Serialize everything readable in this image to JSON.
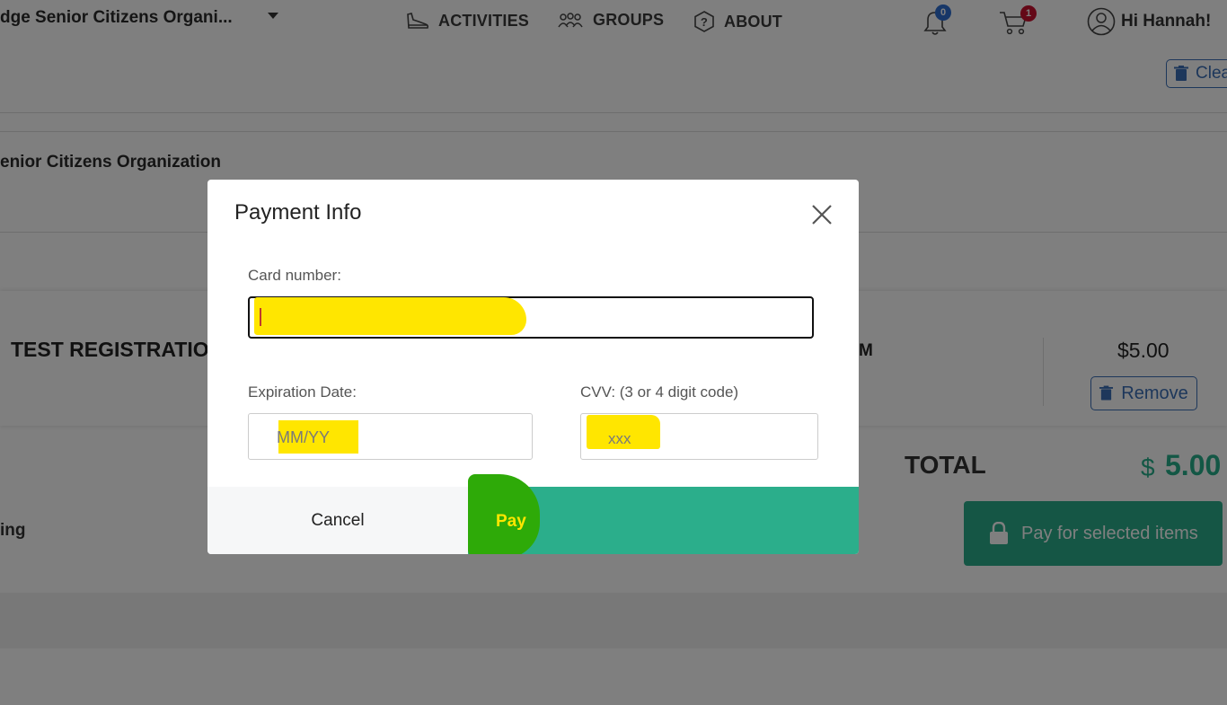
{
  "header": {
    "org_name": "dge Senior Citizens Organi...",
    "nav": [
      {
        "label": "ACTIVITIES",
        "icon": "shoe-icon"
      },
      {
        "label": "GROUPS",
        "icon": "people-icon"
      },
      {
        "label": "ABOUT",
        "icon": "help-icon"
      }
    ],
    "notifications_count": "0",
    "cart_count": "1",
    "greeting": "Hi Hannah!"
  },
  "cart": {
    "clear_label": "Clear",
    "group_name": "enior Citizens Organization",
    "item": {
      "title": "TEST REGISTRATIO",
      "time_fragment": "M",
      "price": "$5.00",
      "remove_label": "Remove"
    },
    "total_label": "TOTAL",
    "total_currency": "$",
    "total_amount": "5.00",
    "pay_selected_label": "Pay for selected items",
    "left_fragment": "ing"
  },
  "modal": {
    "title": "Payment Info",
    "card_label": "Card number:",
    "card_value": "",
    "expiration_label": "Expiration Date:",
    "expiration_placeholder": "MM/YY",
    "cvv_label": "CVV: (3 or 4 digit code)",
    "cvv_placeholder": "xxx",
    "cancel_label": "Cancel",
    "pay_label": "Pay"
  },
  "colors": {
    "accent_green": "#2bae8b",
    "link_blue": "#3a6fb7",
    "highlight_yellow": "#ffe600",
    "highlight_green": "#2eaa08",
    "cart_badge": "#c8102e",
    "bell_badge": "#2f6fd1"
  }
}
